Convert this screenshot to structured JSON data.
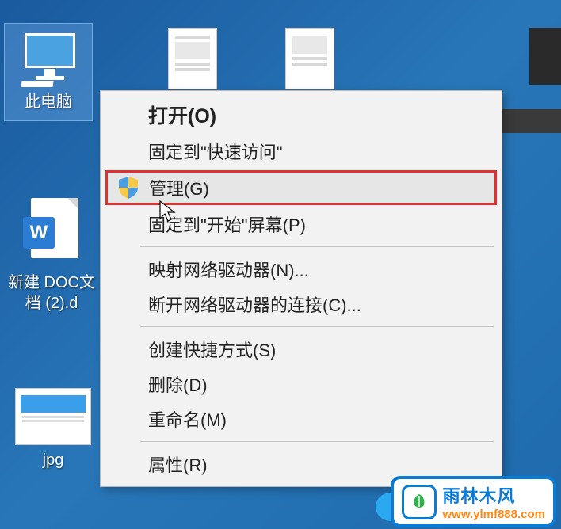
{
  "desktop": {
    "this_pc_label": "此电脑",
    "docx_label": "新建 DOC文档 (2).d",
    "jpg_label": "jpg"
  },
  "context_menu": {
    "open": "打开(O)",
    "pin_quick_access": "固定到\"快速访问\"",
    "manage": "管理(G)",
    "pin_start": "固定到\"开始\"屏幕(P)",
    "map_drive": "映射网络驱动器(N)...",
    "disconnect_drive": "断开网络驱动器的连接(C)...",
    "create_shortcut": "创建快捷方式(S)",
    "delete": "删除(D)",
    "rename": "重命名(M)",
    "properties": "属性(R)"
  },
  "watermark": {
    "brand": "雨林木风",
    "url": "www.ylmf888.com"
  }
}
